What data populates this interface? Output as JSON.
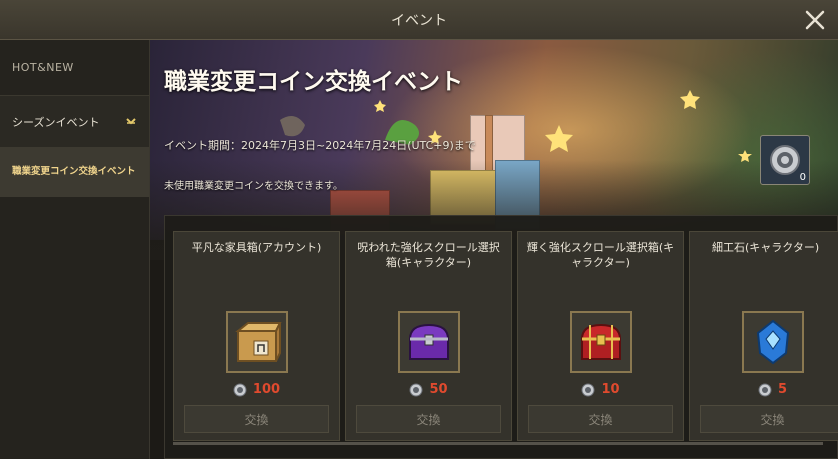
{
  "window": {
    "title": "イベント",
    "close_icon": "close-icon"
  },
  "sidebar": {
    "header": "HOT&NEW",
    "category": {
      "label": "シーズンイベント",
      "icon": "chevron-down-icon"
    },
    "selected_item": "職業変更コイン交換イベント"
  },
  "event": {
    "title": "職業変更コイン交換イベント",
    "period": "イベント期間：2024年7月3日~2024年7月24日(UTC+9)まで",
    "description": "未使用職業変更コインを交換できます。",
    "coin": {
      "icon": "coin-icon",
      "count": "0"
    }
  },
  "items": [
    {
      "name": "平凡な家具箱(アカウント)",
      "icon": "wooden-crate-icon",
      "price": "100",
      "button": "交換"
    },
    {
      "name": "呪われた強化スクロール選択箱(キャラクター)",
      "icon": "purple-chest-icon",
      "price": "50",
      "button": "交換"
    },
    {
      "name": "輝く強化スクロール選択箱(キャラクター)",
      "icon": "red-chest-icon",
      "price": "10",
      "button": "交換"
    },
    {
      "name": "細工石(キャラクター)",
      "icon": "blue-crystal-icon",
      "price": "5",
      "button": "交換"
    }
  ],
  "colors": {
    "price": "#e04a2e",
    "selected_text": "#f1d58d",
    "accent_frame": "#8a7850"
  }
}
